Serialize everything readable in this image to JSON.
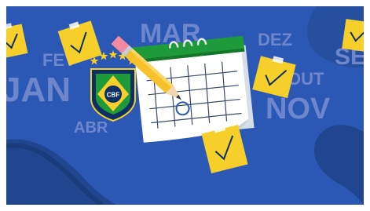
{
  "illustration": {
    "months": {
      "jan": "JAN",
      "fev": "FEV",
      "mar": "MAR",
      "abr": "ABR",
      "dez": "DEZ",
      "out": "OUT",
      "nov": "NOV",
      "set": "SET"
    },
    "badge_text": "CBF",
    "colors": {
      "background": "#2c58b5",
      "month_text": "#6e86cc",
      "calendar_green": "#1f9a3a",
      "note_yellow": "#f6cf2a",
      "crest_navy": "#0c2f66"
    }
  }
}
